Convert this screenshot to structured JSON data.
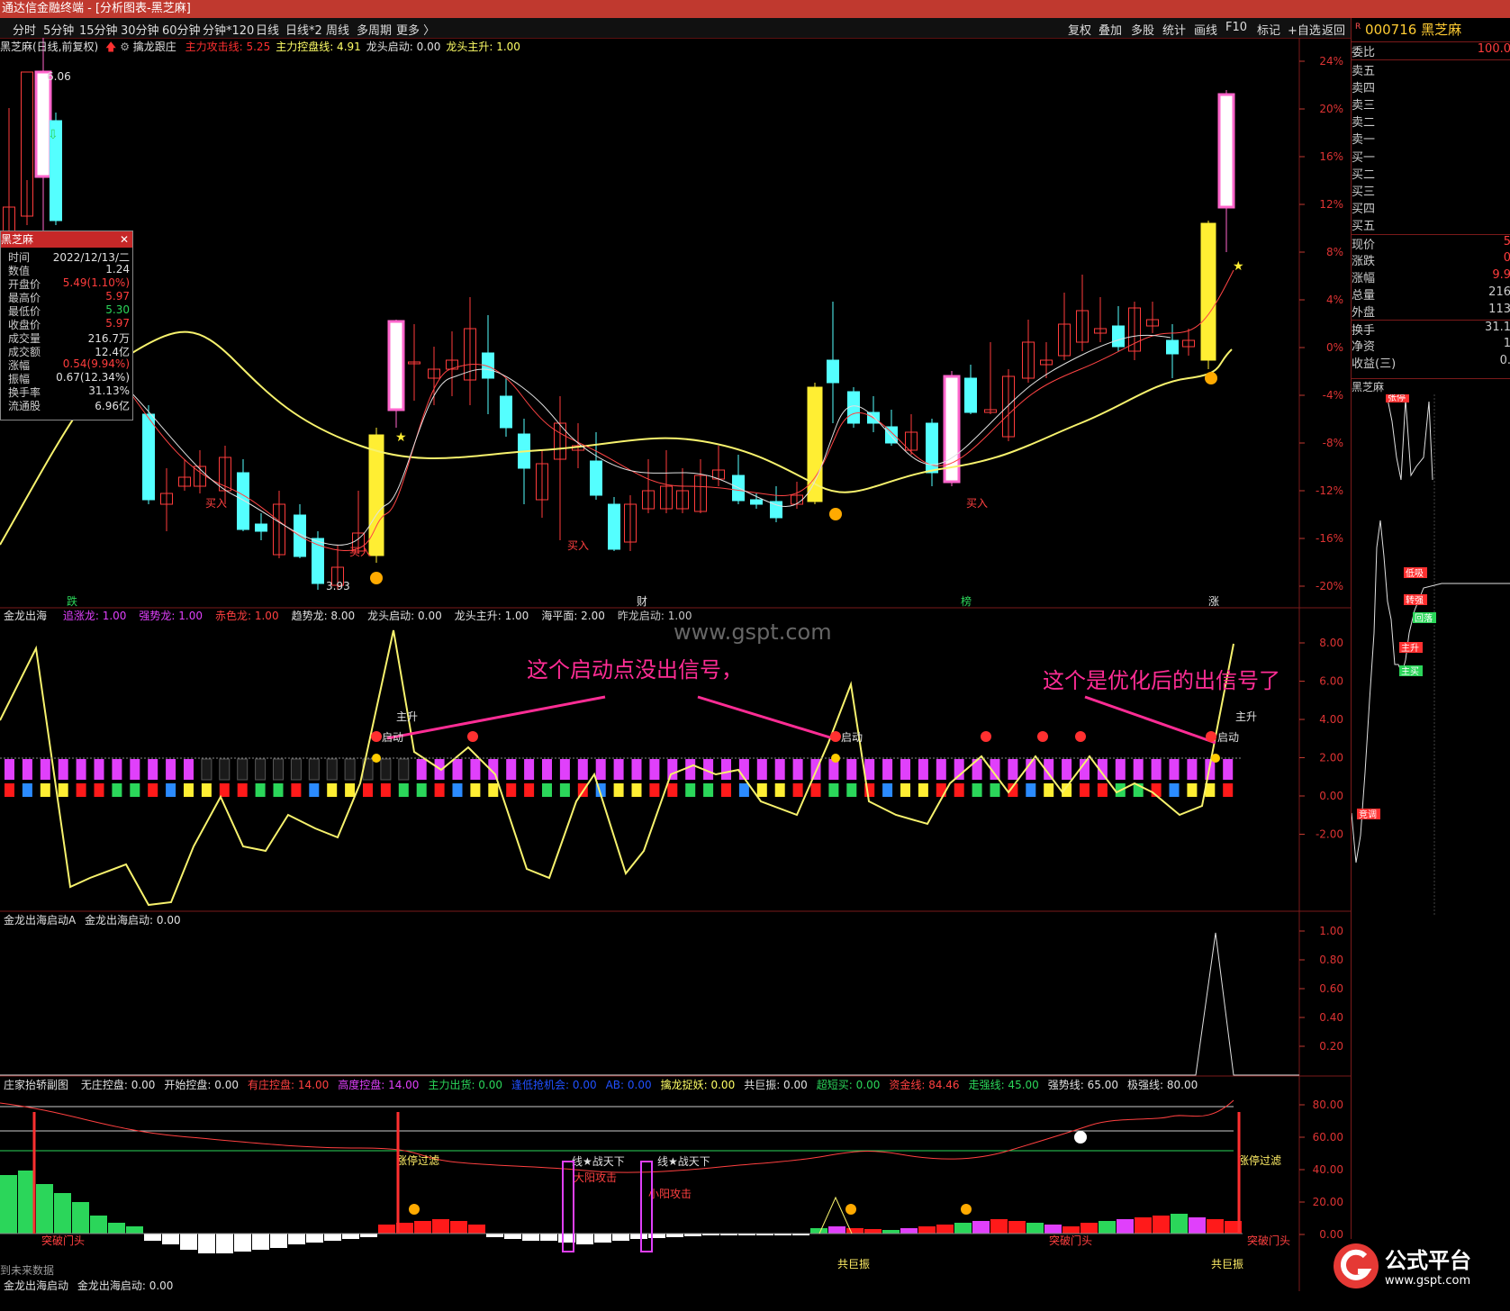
{
  "window": {
    "title": "通达信金融终端 - [分析图表-黑芝麻]"
  },
  "menu": {
    "left": [
      "分时",
      "5分钟",
      "15分钟",
      "30分钟",
      "60分钟",
      "分钟*120",
      "日线",
      "日线*2",
      "周线",
      "多周期",
      "更多 〉"
    ],
    "right": [
      "复权",
      "叠加",
      "多股",
      "统计",
      "画线",
      "F10",
      "标记",
      "+自选",
      "返回"
    ]
  },
  "stock": {
    "code_prefix": "R",
    "code": "000716",
    "name": "黑芝麻"
  },
  "side": {
    "weibi_label": "委比",
    "weibi_value": "100.0",
    "sell": [
      "卖五",
      "卖四",
      "卖三",
      "卖二",
      "卖一"
    ],
    "buy": [
      "买一",
      "买二",
      "买三",
      "买四",
      "买五"
    ],
    "stats": [
      {
        "label": "现价",
        "value": "5"
      },
      {
        "label": "涨跌",
        "value": "0"
      },
      {
        "label": "涨幅",
        "value": "9.9"
      },
      {
        "label": "总量",
        "value": "216"
      },
      {
        "label": "外盘",
        "value": "113"
      },
      {
        "label": "换手",
        "value": "31.1"
      },
      {
        "label": "净资",
        "value": "1"
      },
      {
        "label": "收益(三)",
        "value": "0."
      }
    ],
    "minichart_title": "黑芝麻",
    "minichart_tags": [
      "张停",
      "低吸",
      "转强",
      "回落",
      "主升",
      "主买",
      "竞调"
    ]
  },
  "main_header": {
    "prefix": "黑芝麻(日线,前复权)",
    "study": "擒龙跟庄",
    "items": [
      {
        "text": "主力攻击线: 5.25",
        "color": "#ff3030"
      },
      {
        "text": "主力控盘线: 4.91",
        "color": "#ffff66"
      },
      {
        "text": "龙头启动: 0.00",
        "color": "#e0e0e0"
      },
      {
        "text": "龙头主升: 1.00",
        "color": "#ffff66"
      }
    ]
  },
  "info_box": {
    "title": "黑芝麻",
    "rows": [
      {
        "label": "时间",
        "value": "2022/12/13/二",
        "color": "#e0e0e0"
      },
      {
        "label": "数值",
        "value": "1.24",
        "color": "#e0e0e0"
      },
      {
        "label": "开盘价",
        "value": "5.49(1.10%)",
        "color": "#ff3c3c"
      },
      {
        "label": "最高价",
        "value": "5.97",
        "color": "#ff3c3c"
      },
      {
        "label": "最低价",
        "value": "5.30",
        "color": "#2bd65a"
      },
      {
        "label": "收盘价",
        "value": "5.97",
        "color": "#ff3c3c"
      },
      {
        "label": "成交量",
        "value": "216.7万",
        "color": "#e0e0e0"
      },
      {
        "label": "成交额",
        "value": "12.4亿",
        "color": "#e0e0e0"
      },
      {
        "label": "涨幅",
        "value": "0.54(9.94%)",
        "color": "#ff3c3c"
      },
      {
        "label": "振幅",
        "value": "0.67(12.34%)",
        "color": "#e0e0e0"
      },
      {
        "label": "换手率",
        "value": "31.13%",
        "color": "#e0e0e0"
      },
      {
        "label": "流通股",
        "value": "6.96亿",
        "color": "#e0e0e0"
      }
    ]
  },
  "main_axis": [
    "24%",
    "20%",
    "16%",
    "12%",
    "8%",
    "4%",
    "0%",
    "-4%",
    "-8%",
    "-12%",
    "-16%",
    "-20%"
  ],
  "price_marks": {
    "high": "6.06",
    "low": "3.93"
  },
  "main_labels": {
    "buy": "买入",
    "chars": [
      "跌",
      "财",
      "榜",
      "涨"
    ]
  },
  "pane2_header": {
    "study": "金龙出海",
    "items": [
      {
        "text": "追涨龙: 1.00",
        "color": "#e040fb"
      },
      {
        "text": "强势龙: 1.00",
        "color": "#e040fb"
      },
      {
        "text": "赤色龙: 1.00",
        "color": "#ff4040"
      },
      {
        "text": "趋势龙: 8.00",
        "color": "#e0e0e0"
      },
      {
        "text": "龙头启动: 0.00",
        "color": "#e0e0e0"
      },
      {
        "text": "龙头主升: 1.00",
        "color": "#e0e0e0"
      },
      {
        "text": "海平面: 2.00",
        "color": "#e0e0e0"
      },
      {
        "text": "昨龙启动: 1.00",
        "color": "#c8c8c8"
      }
    ]
  },
  "pane2_axis": [
    "8.00",
    "6.00",
    "4.00",
    "2.00",
    "0.00",
    "-2.00"
  ],
  "pane2_marks": {
    "zhu": "主升",
    "qi": "启动"
  },
  "annotations": {
    "watermark": "www.gspt.com",
    "left": "这个启动点没出信号，",
    "right": "这个是优化后的出信号了"
  },
  "pane3_header": {
    "study": "金龙出海启动A",
    "item": "金龙出海启动: 0.00"
  },
  "pane3_axis": [
    "1.00",
    "0.80",
    "0.60",
    "0.40",
    "0.20"
  ],
  "pane4_header": {
    "study": "庄家抬轿副图",
    "items": [
      {
        "text": "无庄控盘: 0.00",
        "color": "#e0e0e0"
      },
      {
        "text": "开始控盘: 0.00",
        "color": "#e0e0e0"
      },
      {
        "text": "有庄控盘: 14.00",
        "color": "#ff4040"
      },
      {
        "text": "高度控盘: 14.00",
        "color": "#e040fb"
      },
      {
        "text": "主力出货: 0.00",
        "color": "#2bd65a"
      },
      {
        "text": "逢低抢机会: 0.00",
        "color": "#2050ff"
      },
      {
        "text": "AB: 0.00",
        "color": "#2050ff"
      },
      {
        "text": "擒龙捉妖: 0.00",
        "color": "#ffff66"
      },
      {
        "text": "共巨振: 0.00",
        "color": "#e0e0e0"
      },
      {
        "text": "超短买: 0.00",
        "color": "#2bd65a"
      },
      {
        "text": "资金线: 84.46",
        "color": "#ff4040"
      },
      {
        "text": "走强线: 45.00",
        "color": "#2bd65a"
      },
      {
        "text": "强势线: 65.00",
        "color": "#e0e0e0"
      },
      {
        "text": "极强线: 80.00",
        "color": "#e0e0e0"
      }
    ]
  },
  "pane4_axis": [
    "80.00",
    "60.00",
    "40.00",
    "20.00",
    "0.00"
  ],
  "pane4_labels": {
    "tupo": "突破门头",
    "zhangting": "涨停过滤",
    "xian": "线★战天下",
    "dayang": "大阳攻击",
    "xiaoyang": "小阳攻击",
    "gongju": "共巨振"
  },
  "footer": {
    "nodata": "到未来数据",
    "study": "金龙出海启动",
    "item": "金龙出海启动: 0.00"
  },
  "logo": {
    "text": "公式平台",
    "url_text": "www.gspt.com"
  },
  "colors": {
    "up": "#ff3c3c",
    "down": "#54ffff",
    "accent": "#c0392f",
    "ma": "#f7f26d",
    "pink": "#ff66cc"
  }
}
